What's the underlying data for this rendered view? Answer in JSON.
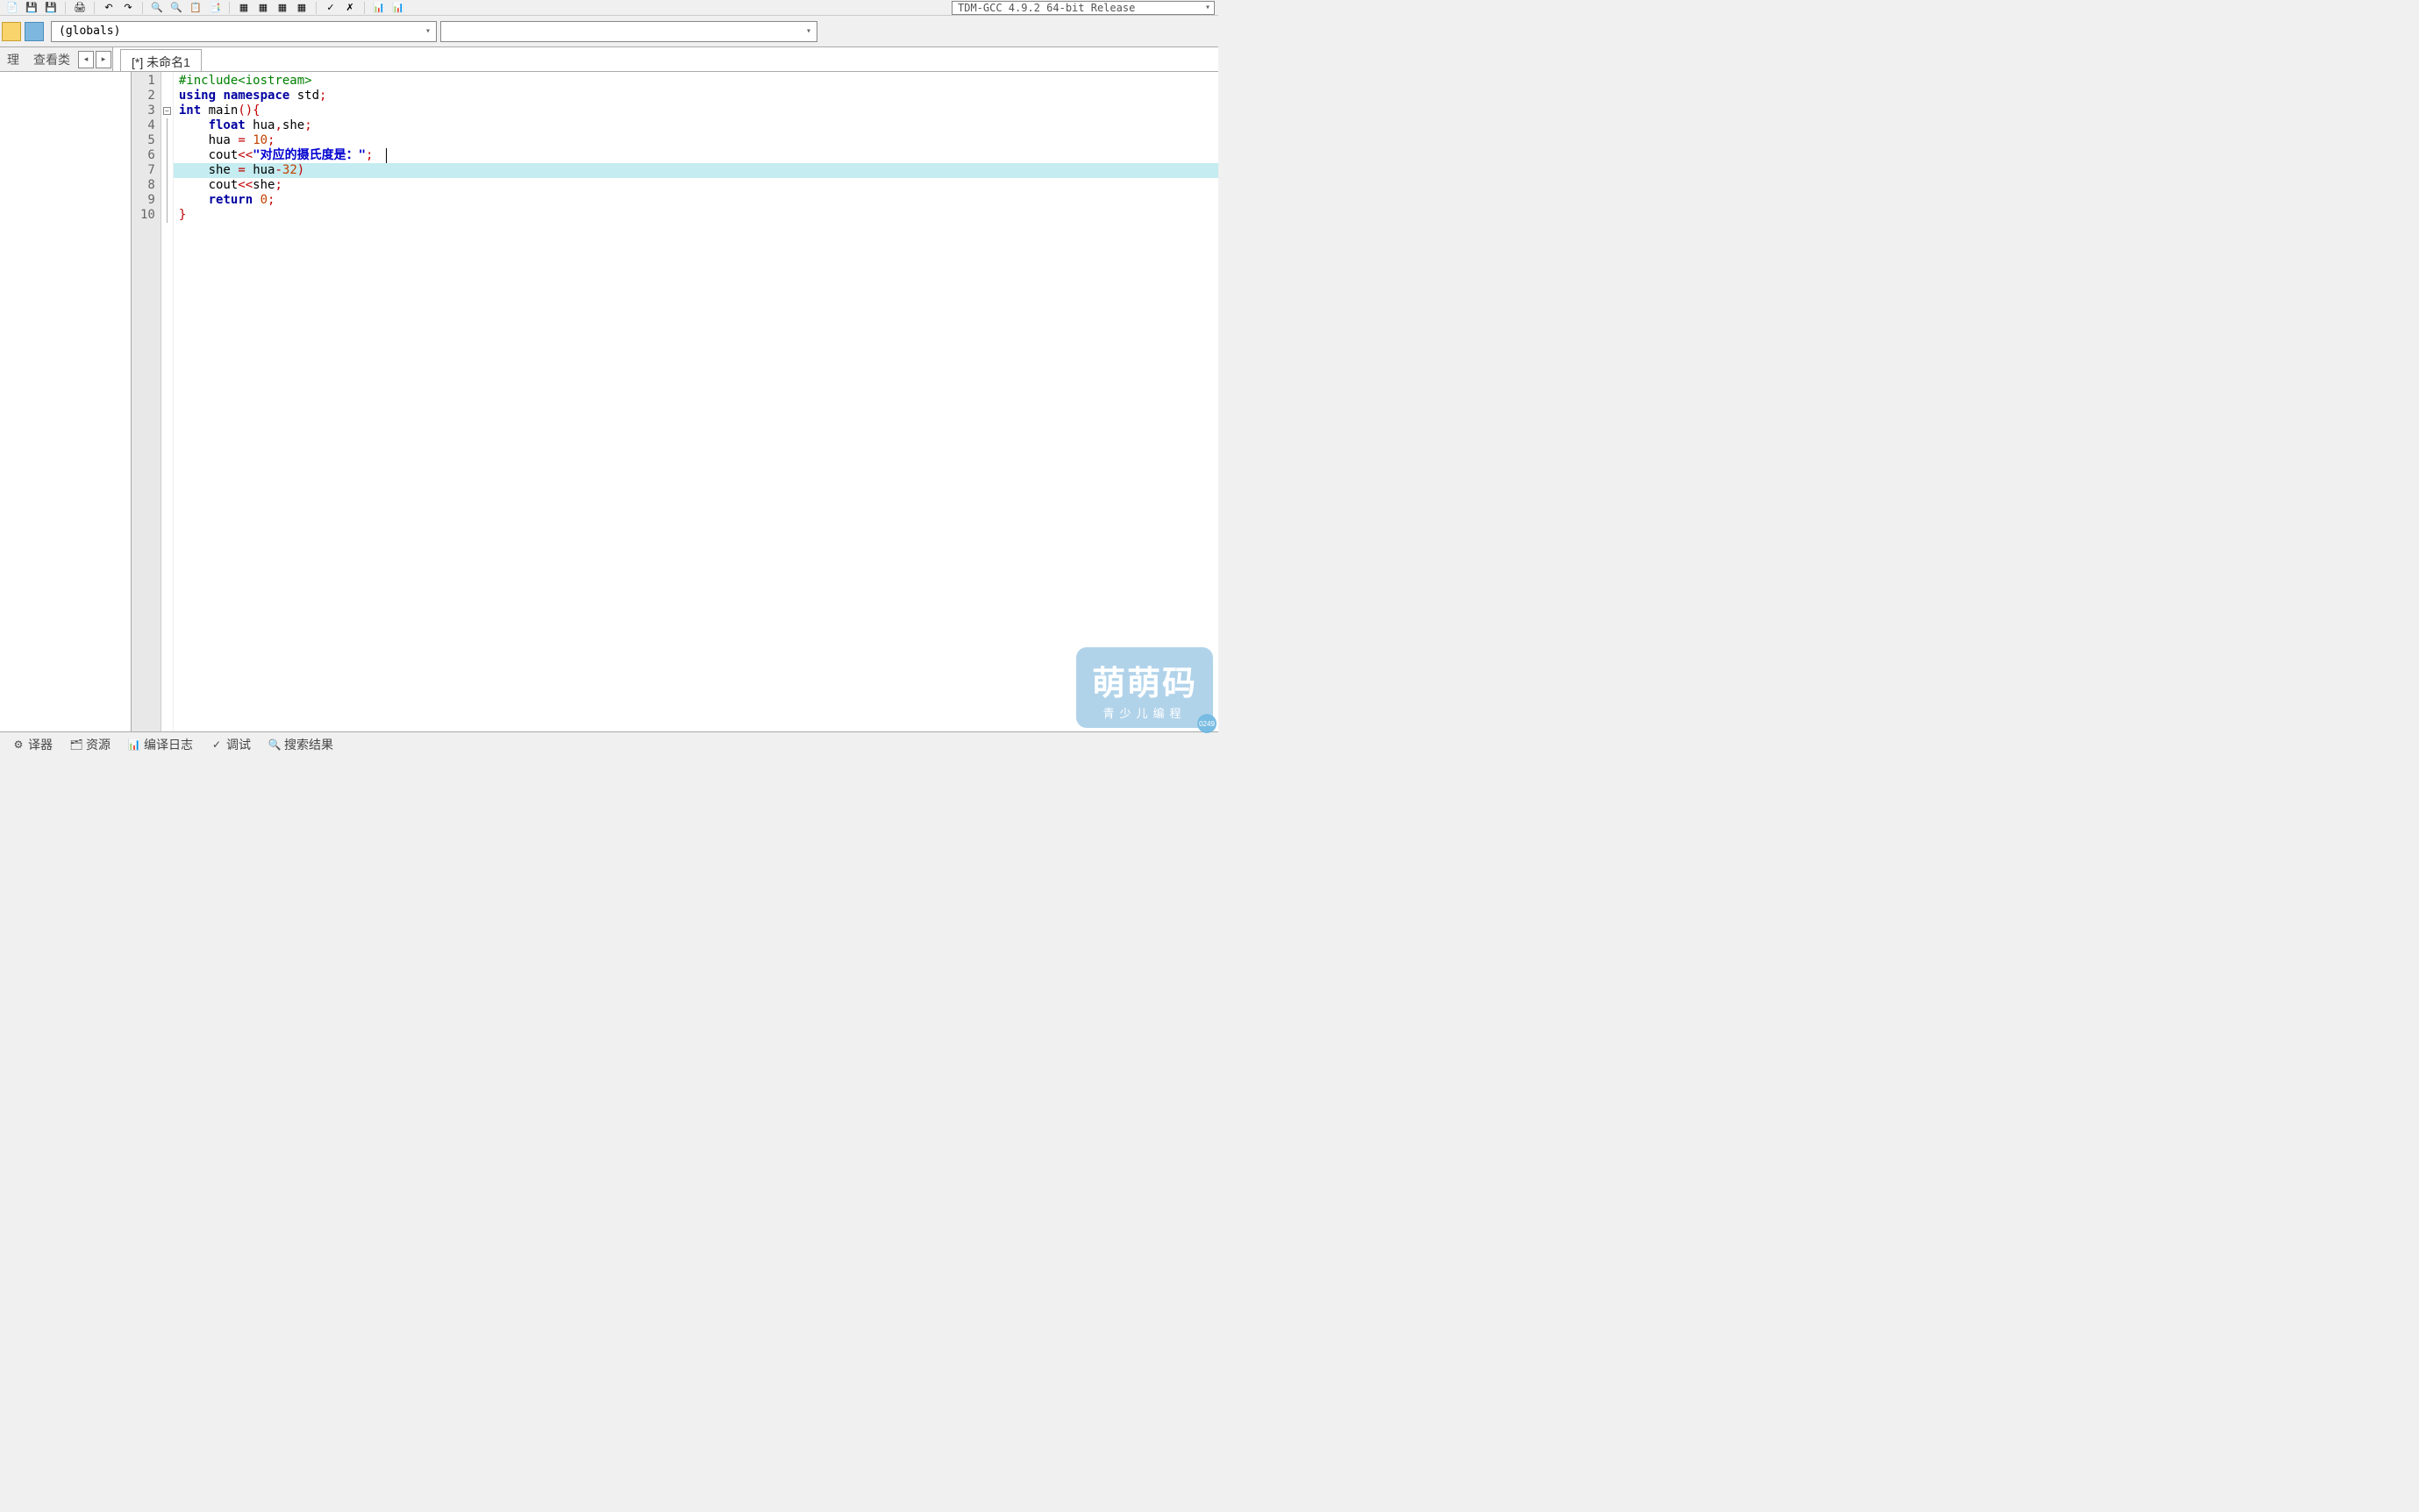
{
  "toolbar": {
    "compiler": "TDM-GCC 4.9.2 64-bit Release"
  },
  "second_toolbar": {
    "scope": "(globals)"
  },
  "side_tabs": {
    "manage": "理",
    "view_class": "查看类"
  },
  "editor_tab": "[*] 未命名1",
  "code": {
    "lines": [
      {
        "n": 1,
        "tokens": [
          {
            "t": "#include",
            "c": "pp"
          },
          {
            "t": "<iostream>",
            "c": "pp"
          }
        ]
      },
      {
        "n": 2,
        "tokens": [
          {
            "t": "using",
            "c": "kw"
          },
          {
            "t": " ",
            "c": ""
          },
          {
            "t": "namespace",
            "c": "kw"
          },
          {
            "t": " ",
            "c": ""
          },
          {
            "t": "std",
            "c": "id"
          },
          {
            "t": ";",
            "c": "punct"
          }
        ]
      },
      {
        "n": 3,
        "fold": true,
        "tokens": [
          {
            "t": "int",
            "c": "kw"
          },
          {
            "t": " ",
            "c": ""
          },
          {
            "t": "main",
            "c": "id"
          },
          {
            "t": "()",
            "c": "op"
          },
          {
            "t": "{",
            "c": "punct"
          }
        ]
      },
      {
        "n": 4,
        "tokens": [
          {
            "t": "    ",
            "c": ""
          },
          {
            "t": "float",
            "c": "kw"
          },
          {
            "t": " ",
            "c": ""
          },
          {
            "t": "hua",
            "c": "id"
          },
          {
            "t": ",",
            "c": "op"
          },
          {
            "t": "she",
            "c": "id"
          },
          {
            "t": ";",
            "c": "punct"
          }
        ]
      },
      {
        "n": 5,
        "tokens": [
          {
            "t": "    ",
            "c": ""
          },
          {
            "t": "hua",
            "c": "id"
          },
          {
            "t": " ",
            "c": ""
          },
          {
            "t": "=",
            "c": "op"
          },
          {
            "t": " ",
            "c": ""
          },
          {
            "t": "10",
            "c": "num"
          },
          {
            "t": ";",
            "c": "punct"
          }
        ]
      },
      {
        "n": 6,
        "tokens": [
          {
            "t": "    ",
            "c": ""
          },
          {
            "t": "cout",
            "c": "id"
          },
          {
            "t": "<<",
            "c": "op"
          },
          {
            "t": "\"对应的摄氏度是：\"",
            "c": "str"
          },
          {
            "t": ";",
            "c": "punct"
          }
        ]
      },
      {
        "n": 7,
        "hl": true,
        "tokens": [
          {
            "t": "    ",
            "c": ""
          },
          {
            "t": "she",
            "c": "id"
          },
          {
            "t": " ",
            "c": ""
          },
          {
            "t": "=",
            "c": "op"
          },
          {
            "t": " ",
            "c": ""
          },
          {
            "t": "hua",
            "c": "id"
          },
          {
            "t": "-",
            "c": "op"
          },
          {
            "t": "32",
            "c": "num"
          },
          {
            "t": ")",
            "c": "op"
          }
        ]
      },
      {
        "n": 8,
        "tokens": [
          {
            "t": "    ",
            "c": ""
          },
          {
            "t": "cout",
            "c": "id"
          },
          {
            "t": "<<",
            "c": "op"
          },
          {
            "t": "she",
            "c": "id"
          },
          {
            "t": ";",
            "c": "punct"
          }
        ]
      },
      {
        "n": 9,
        "tokens": [
          {
            "t": "    ",
            "c": ""
          },
          {
            "t": "return",
            "c": "kw"
          },
          {
            "t": " ",
            "c": ""
          },
          {
            "t": "0",
            "c": "num"
          },
          {
            "t": ";",
            "c": "punct"
          }
        ]
      },
      {
        "n": 10,
        "tokens": [
          {
            "t": "}",
            "c": "punct"
          }
        ]
      }
    ]
  },
  "bottom_tabs": {
    "compiler": "译器",
    "resources": "资源",
    "compile_log": "编译日志",
    "debug": "调试",
    "search_results": "搜索结果"
  },
  "watermark": {
    "title": "萌萌码",
    "subtitle": "青少儿编程",
    "badge": "0249"
  }
}
